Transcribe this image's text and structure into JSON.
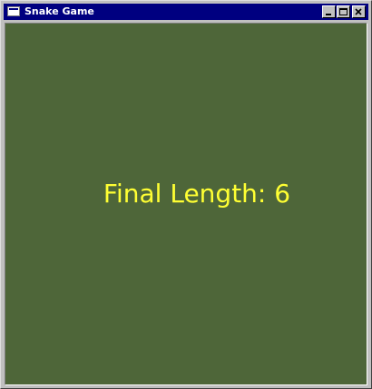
{
  "window": {
    "title": "Snake Game"
  },
  "game": {
    "final_length_label": "Final Length: 6",
    "final_length": 6
  },
  "colors": {
    "title_bar": "#000080",
    "playfield": "#4e6639",
    "text": "#ffff33"
  },
  "icons": {
    "app": "window-icon",
    "minimize": "minimize-icon",
    "maximize": "maximize-icon",
    "close": "close-icon"
  }
}
